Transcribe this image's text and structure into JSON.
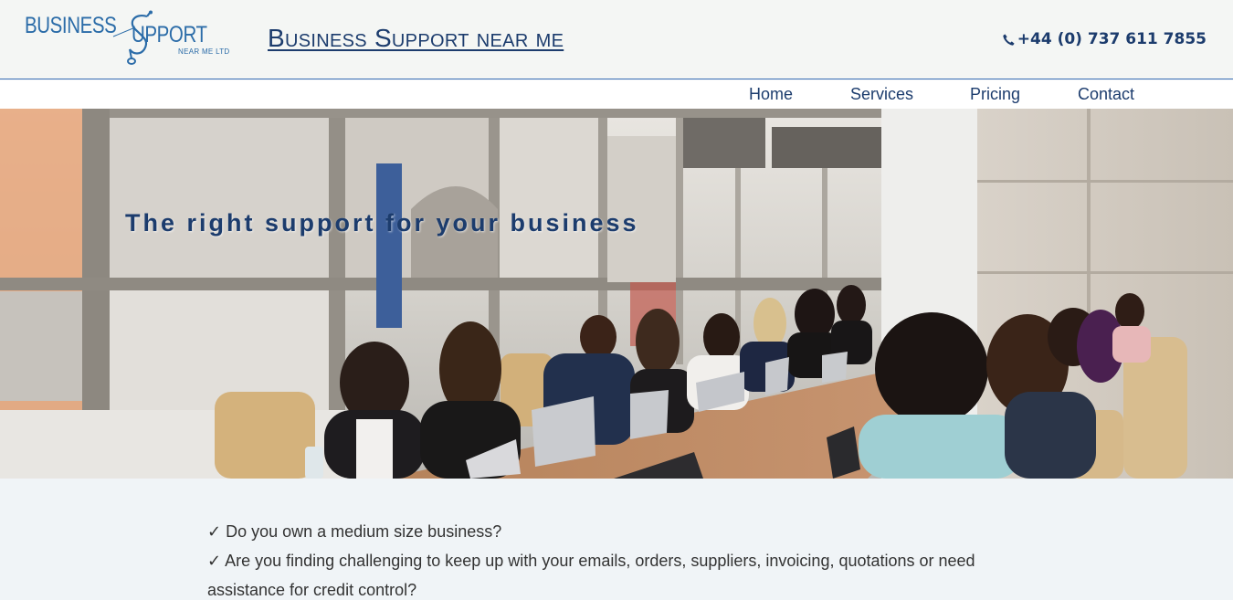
{
  "header": {
    "logo": {
      "line1": "BUSINESS",
      "line2": "UPPORT",
      "sub": "NEAR ME LTD",
      "icon": "stethoscope-s-icon"
    },
    "site_title": "Business Support near me",
    "phone": {
      "icon": "phone-icon",
      "number": "+44 (0) 737 611 7855"
    }
  },
  "nav": {
    "items": [
      {
        "label": "Home"
      },
      {
        "label": "Services"
      },
      {
        "label": "Pricing"
      },
      {
        "label": "Contact"
      }
    ]
  },
  "hero": {
    "heading": "The right support for your business"
  },
  "content": {
    "lines": [
      "✓ Do you own a medium size business?",
      "✓ Are you finding challenging to keep up with your emails, orders, suppliers, invoicing, quotations or need assistance for credit control?"
    ]
  },
  "colors": {
    "brand_dark": "#1c3c6d",
    "brand_blue": "#2b6ca8",
    "header_bg": "#f4f6f4",
    "page_bg": "#f0f4f7",
    "divider": "#3b6fb5"
  }
}
